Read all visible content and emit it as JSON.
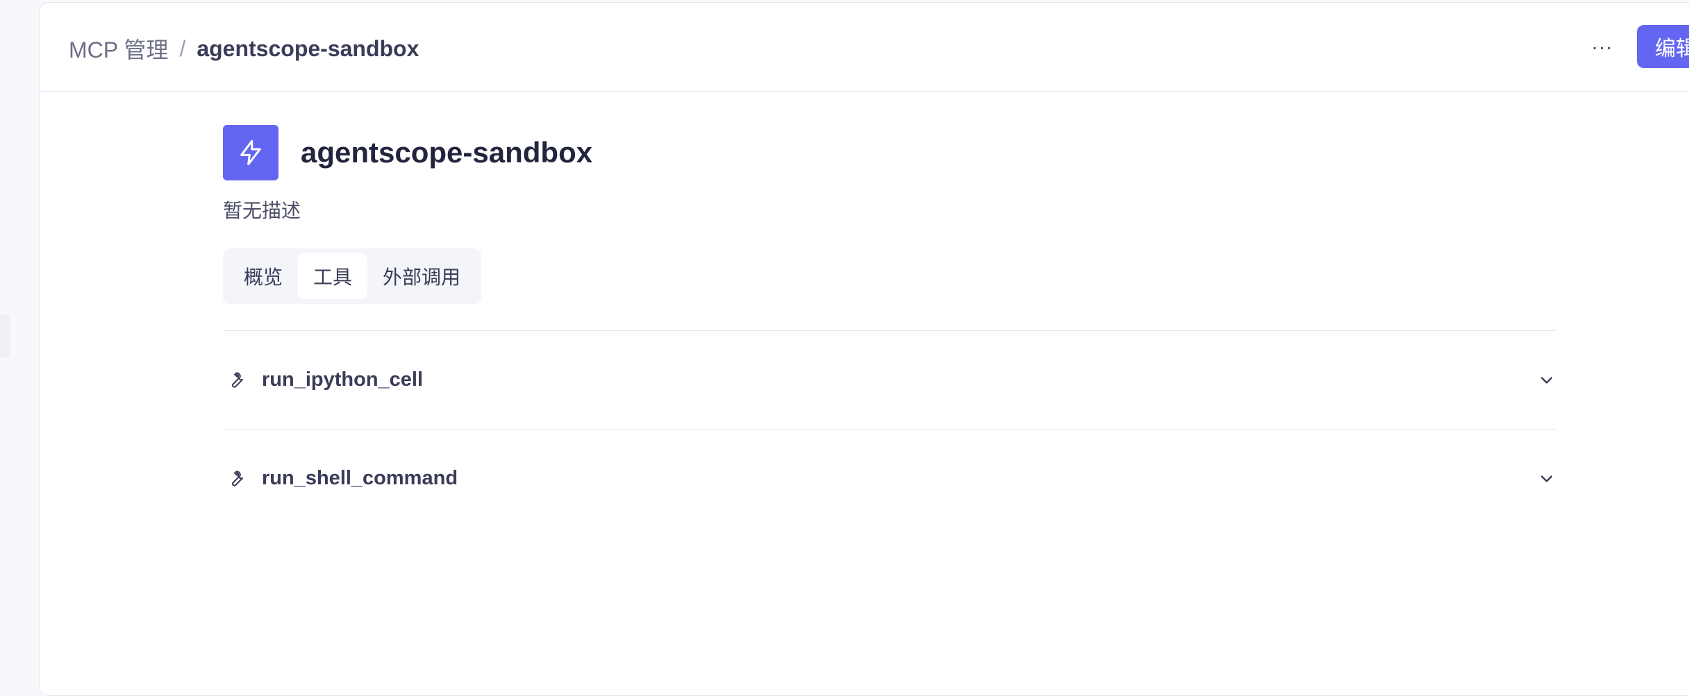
{
  "breadcrumb": {
    "parent": "MCP 管理",
    "separator": "/",
    "current": "agentscope-sandbox"
  },
  "header": {
    "more_label": "···",
    "edit_label": "编辑"
  },
  "server": {
    "name": "agentscope-sandbox",
    "description": "暂无描述",
    "icon": "lightning-icon"
  },
  "tabs": [
    {
      "label": "概览",
      "active": false
    },
    {
      "label": "工具",
      "active": true
    },
    {
      "label": "外部调用",
      "active": false
    }
  ],
  "tools": [
    {
      "name": "run_ipython_cell",
      "icon": "wrench-icon"
    },
    {
      "name": "run_shell_command",
      "icon": "wrench-icon"
    }
  ],
  "colors": {
    "accent": "#6366f1",
    "border": "#e3e5ec",
    "text": "#2b2d4a"
  }
}
